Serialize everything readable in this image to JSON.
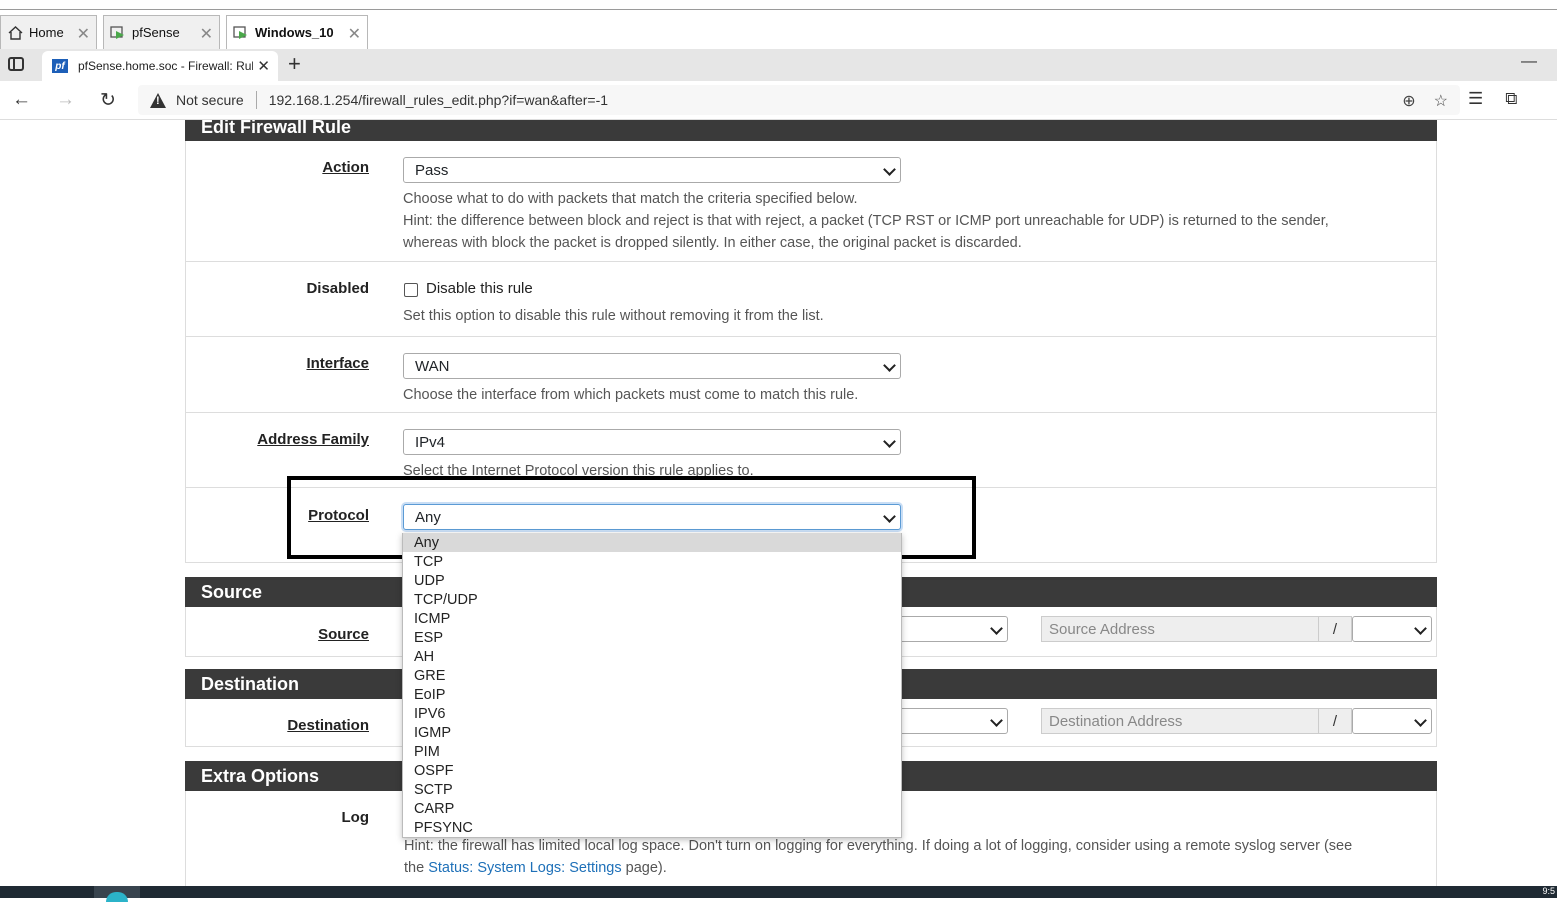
{
  "vm_tabs": [
    {
      "label": "Home",
      "icon": "home-icon"
    },
    {
      "label": "pfSense",
      "icon": "vm-console-icon"
    },
    {
      "label": "Windows_10",
      "icon": "vm-console-icon",
      "active": true
    }
  ],
  "browser": {
    "tab_title": "pfSense.home.soc - Firewall: Rule",
    "favicon_text": "pf",
    "security_label": "Not secure",
    "url": "192.168.1.254/firewall_rules_edit.php?if=wan&after=-1"
  },
  "edit_panel": {
    "title": "Edit Firewall Rule",
    "action": {
      "label": "Action",
      "value": "Pass",
      "help1": "Choose what to do with packets that match the criteria specified below.",
      "help2": "Hint: the difference between block and reject is that with reject, a packet (TCP RST or ICMP port unreachable for UDP) is returned to the sender,",
      "help3": "whereas with block the packet is dropped silently. In either case, the original packet is discarded."
    },
    "disabled": {
      "label": "Disabled",
      "checkbox_label": "Disable this rule",
      "checked": false,
      "help": "Set this option to disable this rule without removing it from the list."
    },
    "interface": {
      "label": "Interface",
      "value": "WAN",
      "help": "Choose the interface from which packets must come to match this rule."
    },
    "address_family": {
      "label": "Address Family",
      "value": "IPv4",
      "help": "Select the Internet Protocol version this rule applies to."
    },
    "protocol": {
      "label": "Protocol",
      "value": "Any",
      "options": [
        "Any",
        "TCP",
        "UDP",
        "TCP/UDP",
        "ICMP",
        "ESP",
        "AH",
        "GRE",
        "EoIP",
        "IPV6",
        "IGMP",
        "PIM",
        "OSPF",
        "SCTP",
        "CARP",
        "PFSYNC"
      ],
      "selected_index": 0
    }
  },
  "source_panel": {
    "title": "Source",
    "label": "Source",
    "address_placeholder": "Source Address",
    "slash": "/"
  },
  "destination_panel": {
    "title": "Destination",
    "label": "Destination",
    "address_placeholder": "Destination Address",
    "slash": "/"
  },
  "extra_panel": {
    "title": "Extra Options",
    "log_label": "Log",
    "log_help_line1": "Hint: the firewall has limited local log space. Don't turn on logging for everything. If doing a lot of logging, consider using a remote syslog server (see",
    "log_help_the": "the ",
    "log_help_link": "Status: System Logs: Settings",
    "log_help_end": " page)."
  },
  "taskbar": {
    "clock": "9:5"
  },
  "colors": {
    "panel_header": "#3a3a3a",
    "link": "#1e70b8",
    "focus": "#5b9bd5"
  }
}
